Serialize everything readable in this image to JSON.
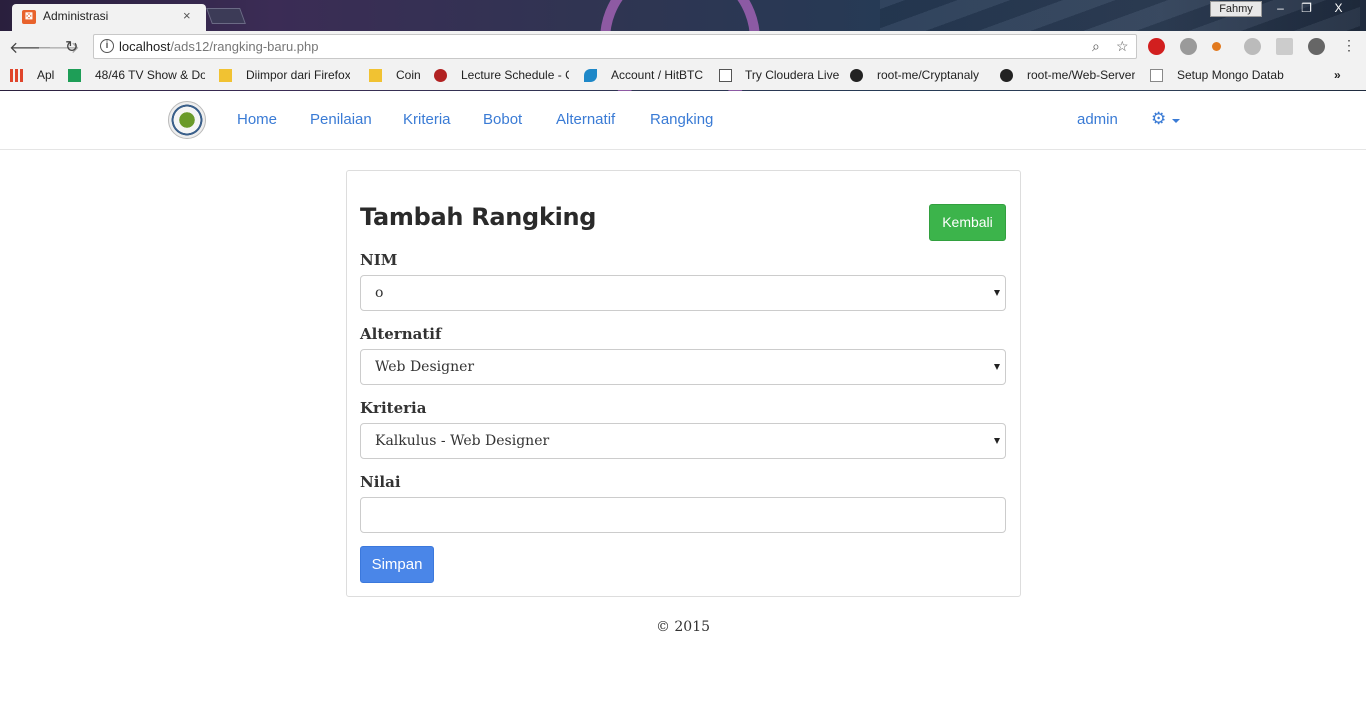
{
  "browser": {
    "tab_title": "Administrasi",
    "tab_close": "×",
    "profile_name": "Fahmy",
    "url_host": "localhost",
    "url_path": "/ads12/rangking-baru.php",
    "window_buttons": [
      "–",
      "❐",
      "X"
    ],
    "bookmarks": [
      {
        "label": "Apl",
        "icon_color": "#e0452b"
      },
      {
        "label": "48/46 TV Show & Do",
        "icon_color": "#1e9e57"
      },
      {
        "label": "Diimpor dari Firefox",
        "icon_color": "#f1c232"
      },
      {
        "label": "Coin",
        "icon_color": "#f1c232"
      },
      {
        "label": "Lecture Schedule - C",
        "icon_color": "#b22222"
      },
      {
        "label": "Account / HitBTC",
        "icon_color": "#1e88c8"
      },
      {
        "label": "Try Cloudera Live",
        "icon_color": "#ffffff"
      },
      {
        "label": "root-me/Cryptanaly",
        "icon_color": "#222222"
      },
      {
        "label": "root-me/Web-Server",
        "icon_color": "#222222"
      },
      {
        "label": "Setup Mongo Datab",
        "icon_color": "#ffffff"
      }
    ],
    "bookmarks_more": "»"
  },
  "navbar": {
    "links": [
      "Home",
      "Penilaian",
      "Kriteria",
      "Bobot",
      "Alternatif",
      "Rangking"
    ],
    "user": "admin"
  },
  "form": {
    "title": "Tambah Rangking",
    "back_label": "Kembali",
    "nim_label": "NIM",
    "nim_value": "o",
    "alternatif_label": "Alternatif",
    "alternatif_value": "Web Designer",
    "kriteria_label": "Kriteria",
    "kriteria_value": "Kalkulus - Web Designer",
    "nilai_label": "Nilai",
    "nilai_value": "",
    "save_label": "Simpan"
  },
  "footer": {
    "text": "© 2015"
  },
  "colors": {
    "accent": "#3a7bd5",
    "back_button": "#3cb44b",
    "save_button": "#4a86e8"
  }
}
